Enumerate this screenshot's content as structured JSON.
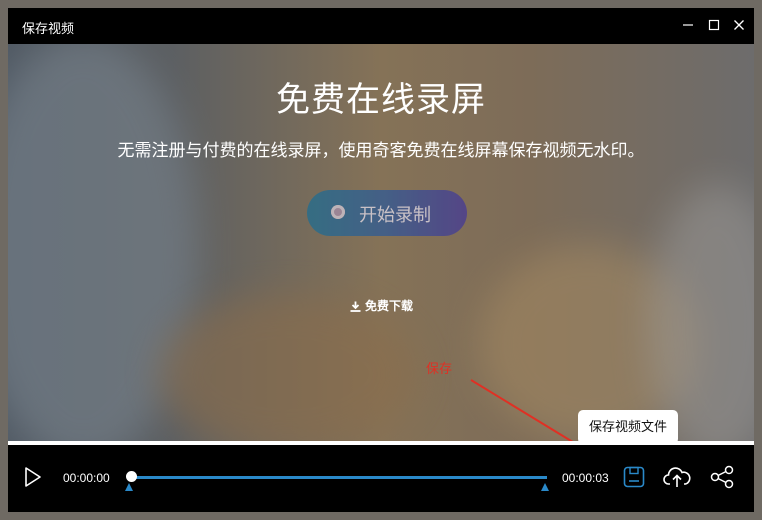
{
  "window": {
    "title": "保存视频",
    "controls": [
      "minimize-icon",
      "maximize-icon",
      "close-icon"
    ]
  },
  "video": {
    "headline": "免费在线录屏",
    "subline": "无需注册与付费的在线录屏，使用奇客免费在线屏幕保存视频无水印。",
    "record_button_label": "开始录制",
    "download_label": "免费下载",
    "annotation_label": "保存"
  },
  "player": {
    "current_time": "00:00:00",
    "total_time": "00:00:03",
    "progress": 0,
    "tooltip": "保存视频文件",
    "icons": [
      "play-icon",
      "save-file-icon",
      "upload-cloud-icon",
      "share-icon"
    ]
  },
  "colors": {
    "accent": "#2a89c9",
    "annotation": "#e03024",
    "background": "#000000"
  }
}
